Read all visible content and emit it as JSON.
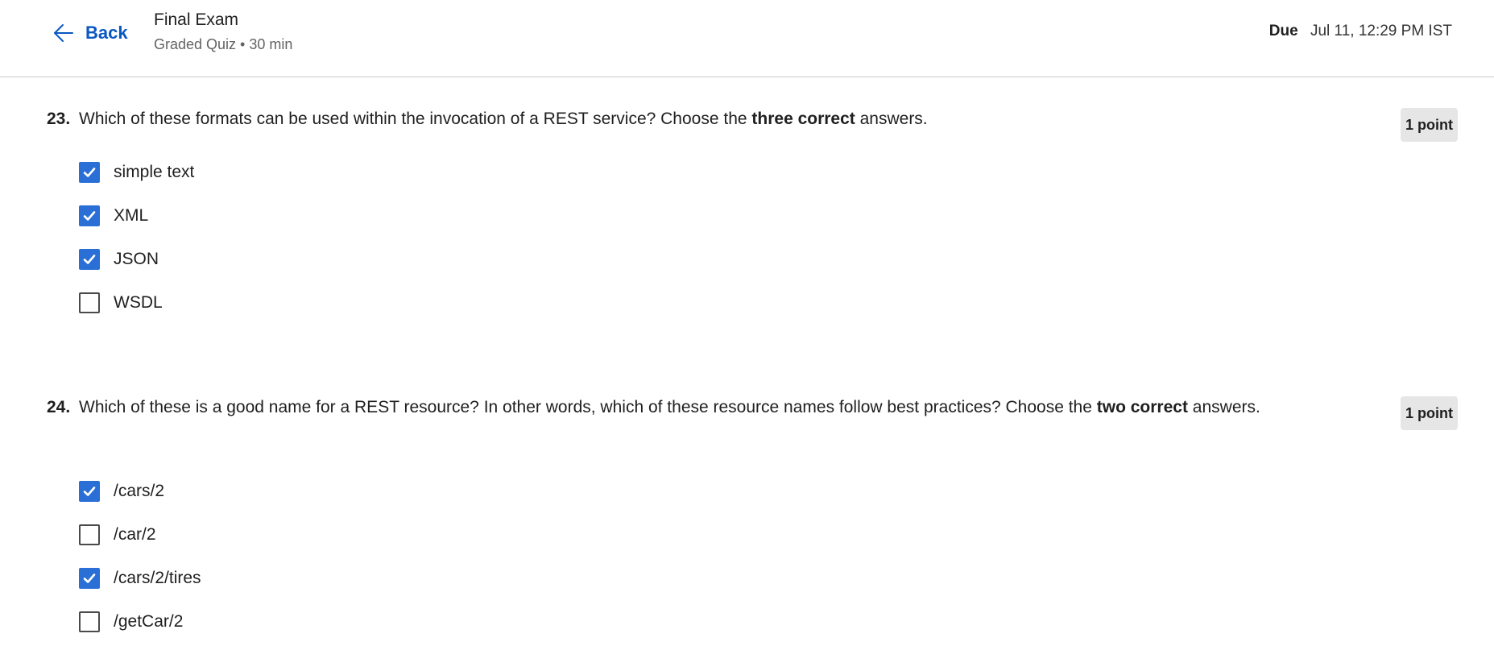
{
  "header": {
    "back_label": "Back",
    "title": "Final Exam",
    "meta": "Graded Quiz • 30 min",
    "due_label": "Due",
    "due_value": "Jul 11, 12:29 PM IST"
  },
  "questions": [
    {
      "number": "23.",
      "text_before": "Which of these formats can be used within the invocation of a REST service? Choose the ",
      "text_bold": "three correct",
      "text_after": " answers.",
      "points": "1 point",
      "options": [
        {
          "label": "simple text",
          "checked": true
        },
        {
          "label": "XML",
          "checked": true
        },
        {
          "label": "JSON",
          "checked": true
        },
        {
          "label": "WSDL",
          "checked": false
        }
      ]
    },
    {
      "number": "24.",
      "text_before": "Which of these is a good name for a REST resource? In other words, which of these resource names follow best practices? Choose the ",
      "text_bold": "two correct",
      "text_after": " answers.",
      "points": "1 point",
      "options": [
        {
          "label": "/cars/2",
          "checked": true
        },
        {
          "label": "/car/2",
          "checked": false
        },
        {
          "label": "/cars/2/tires",
          "checked": true
        },
        {
          "label": "/getCar/2",
          "checked": false
        }
      ]
    }
  ],
  "colors": {
    "accent": "#0a57c2",
    "checkbox_checked": "#2a6fd6",
    "points_badge_bg": "#e6e6e6"
  },
  "icons": {
    "back": "arrow-left-icon",
    "checked": "checkmark-icon"
  }
}
